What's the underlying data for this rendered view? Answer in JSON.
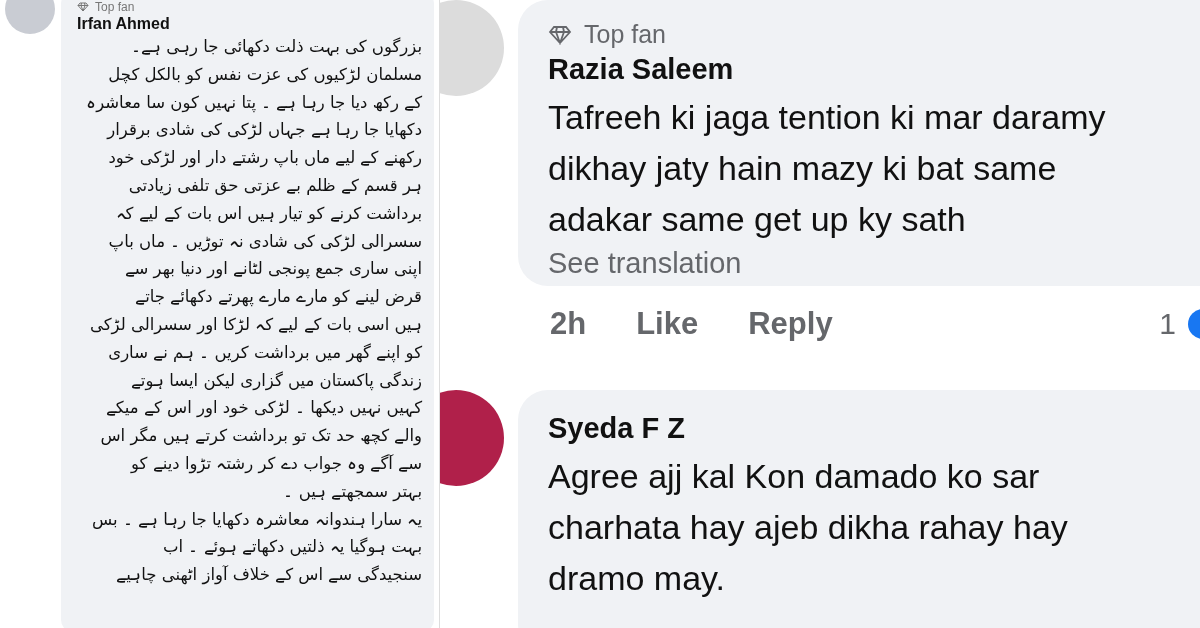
{
  "left_comment": {
    "badge": "Top fan",
    "author": "Irfan Ahmed",
    "lines": [
      "بزرگوں کی بہت ذلت دکھائی جا رہی ہے۔",
      "مسلمان لڑکیوں کی عزت نفس کو بالکل کچل",
      "کے رکھ دیا جا رہا ہے ۔ پتا نہیں کون سا معاشرہ",
      "دکھایا جا رہا ہے جہاں لڑکی کی شادی برقرار",
      "رکھنے کے لیے ماں باپ رشتے دار اور لڑکی خود",
      "ہر قسم کے ظلم بے عزتی حق تلفی زیادتی",
      "برداشت کرنے کو تیار ہیں اس بات کے لیے کہ",
      "سسرالی لڑکی کی شادی نہ توڑیں ۔ ماں باپ",
      "اپنی ساری جمع پونجی لٹانے اور دنیا بھر سے",
      "قرض لینے کو مارے مارے پھرتے دکھائے جاتے",
      "ہیں اسی بات کے لیے کہ لڑکا اور سسرالی لڑکی",
      "کو اپنے گھر میں برداشت کریں ۔ ہم نے ساری",
      "زندگی پاکستان میں گزاری لیکن ایسا ہوتے",
      "کہیں نہیں دیکھا ۔ لڑکی خود اور اس کے میکے",
      "والے کچھ حد تک تو برداشت کرتے ہیں مگر اس",
      "سے آگے وہ جواب دے کر رشتہ تڑوا دینے کو",
      "بہتر سمجھتے ہیں ۔",
      "یہ سارا ہندوانہ معاشرہ دکھایا جا رہا ہے ۔ بس",
      "بہت ہوگیا یہ ذلتیں دکھاتے ہوئے ۔ اب",
      "سنجیدگی سے اس کے خلاف آواز اٹھنی چاہیے"
    ]
  },
  "right_comments": [
    {
      "badge": "Top fan",
      "author": "Razia Saleem",
      "lines": [
        "Tafreeh ki jaga tention ki mar daramy",
        "dikhay jaty hain mazy ki bat same",
        "adakar same get up ky sath"
      ],
      "translation_link": "See translation",
      "time": "2h",
      "like_label": "Like",
      "reply_label": "Reply",
      "reaction_count": "1"
    },
    {
      "author": "Syeda F Z",
      "lines": [
        "Agree ajj kal Kon damado ko sar",
        "charhata hay ajeb dikha rahay hay",
        "dramo may."
      ]
    }
  ]
}
